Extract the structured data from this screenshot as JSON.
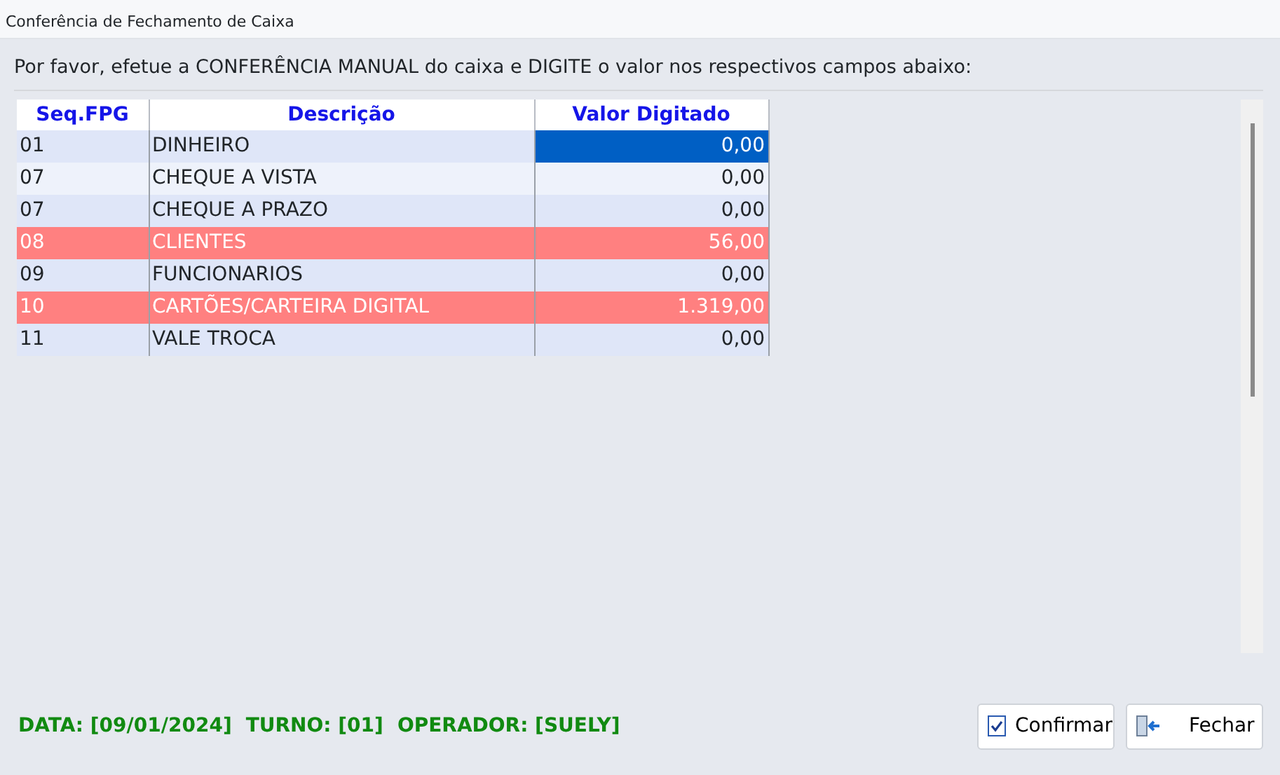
{
  "window": {
    "title": "Conferência de Fechamento de Caixa"
  },
  "instruction": "Por favor, efetue a CONFERÊNCIA MANUAL do caixa e DIGITE o valor nos respectivos campos abaixo:",
  "table": {
    "columns": [
      "Seq.FPG",
      "Descrição",
      "Valor Digitado"
    ],
    "rows": [
      {
        "cells": [
          "01",
          "DINHEIRO",
          "0,00"
        ],
        "highlighted": false,
        "selected": true
      },
      {
        "cells": [
          "07",
          "CHEQUE A VISTA",
          "0,00"
        ],
        "highlighted": false,
        "selected": false
      },
      {
        "cells": [
          "07",
          "CHEQUE A PRAZO",
          "0,00"
        ],
        "highlighted": false,
        "selected": false
      },
      {
        "cells": [
          "08",
          "CLIENTES",
          "56,00"
        ],
        "highlighted": true,
        "selected": false
      },
      {
        "cells": [
          "09",
          "FUNCIONARIOS",
          "0,00"
        ],
        "highlighted": false,
        "selected": false
      },
      {
        "cells": [
          "10",
          "CARTÕES/CARTEIRA DIGITAL",
          "1.319,00"
        ],
        "highlighted": true,
        "selected": false
      },
      {
        "cells": [
          "11",
          "VALE TROCA",
          "0,00"
        ],
        "highlighted": false,
        "selected": false
      }
    ]
  },
  "status": [
    "DATA: [09/01/2024]",
    "TURNO: [01]",
    "OPERADOR: [SUELY]"
  ],
  "buttons": [
    {
      "label": "Confirmar",
      "kind": "confirm"
    },
    {
      "label": "Fechar",
      "kind": "close"
    }
  ]
}
